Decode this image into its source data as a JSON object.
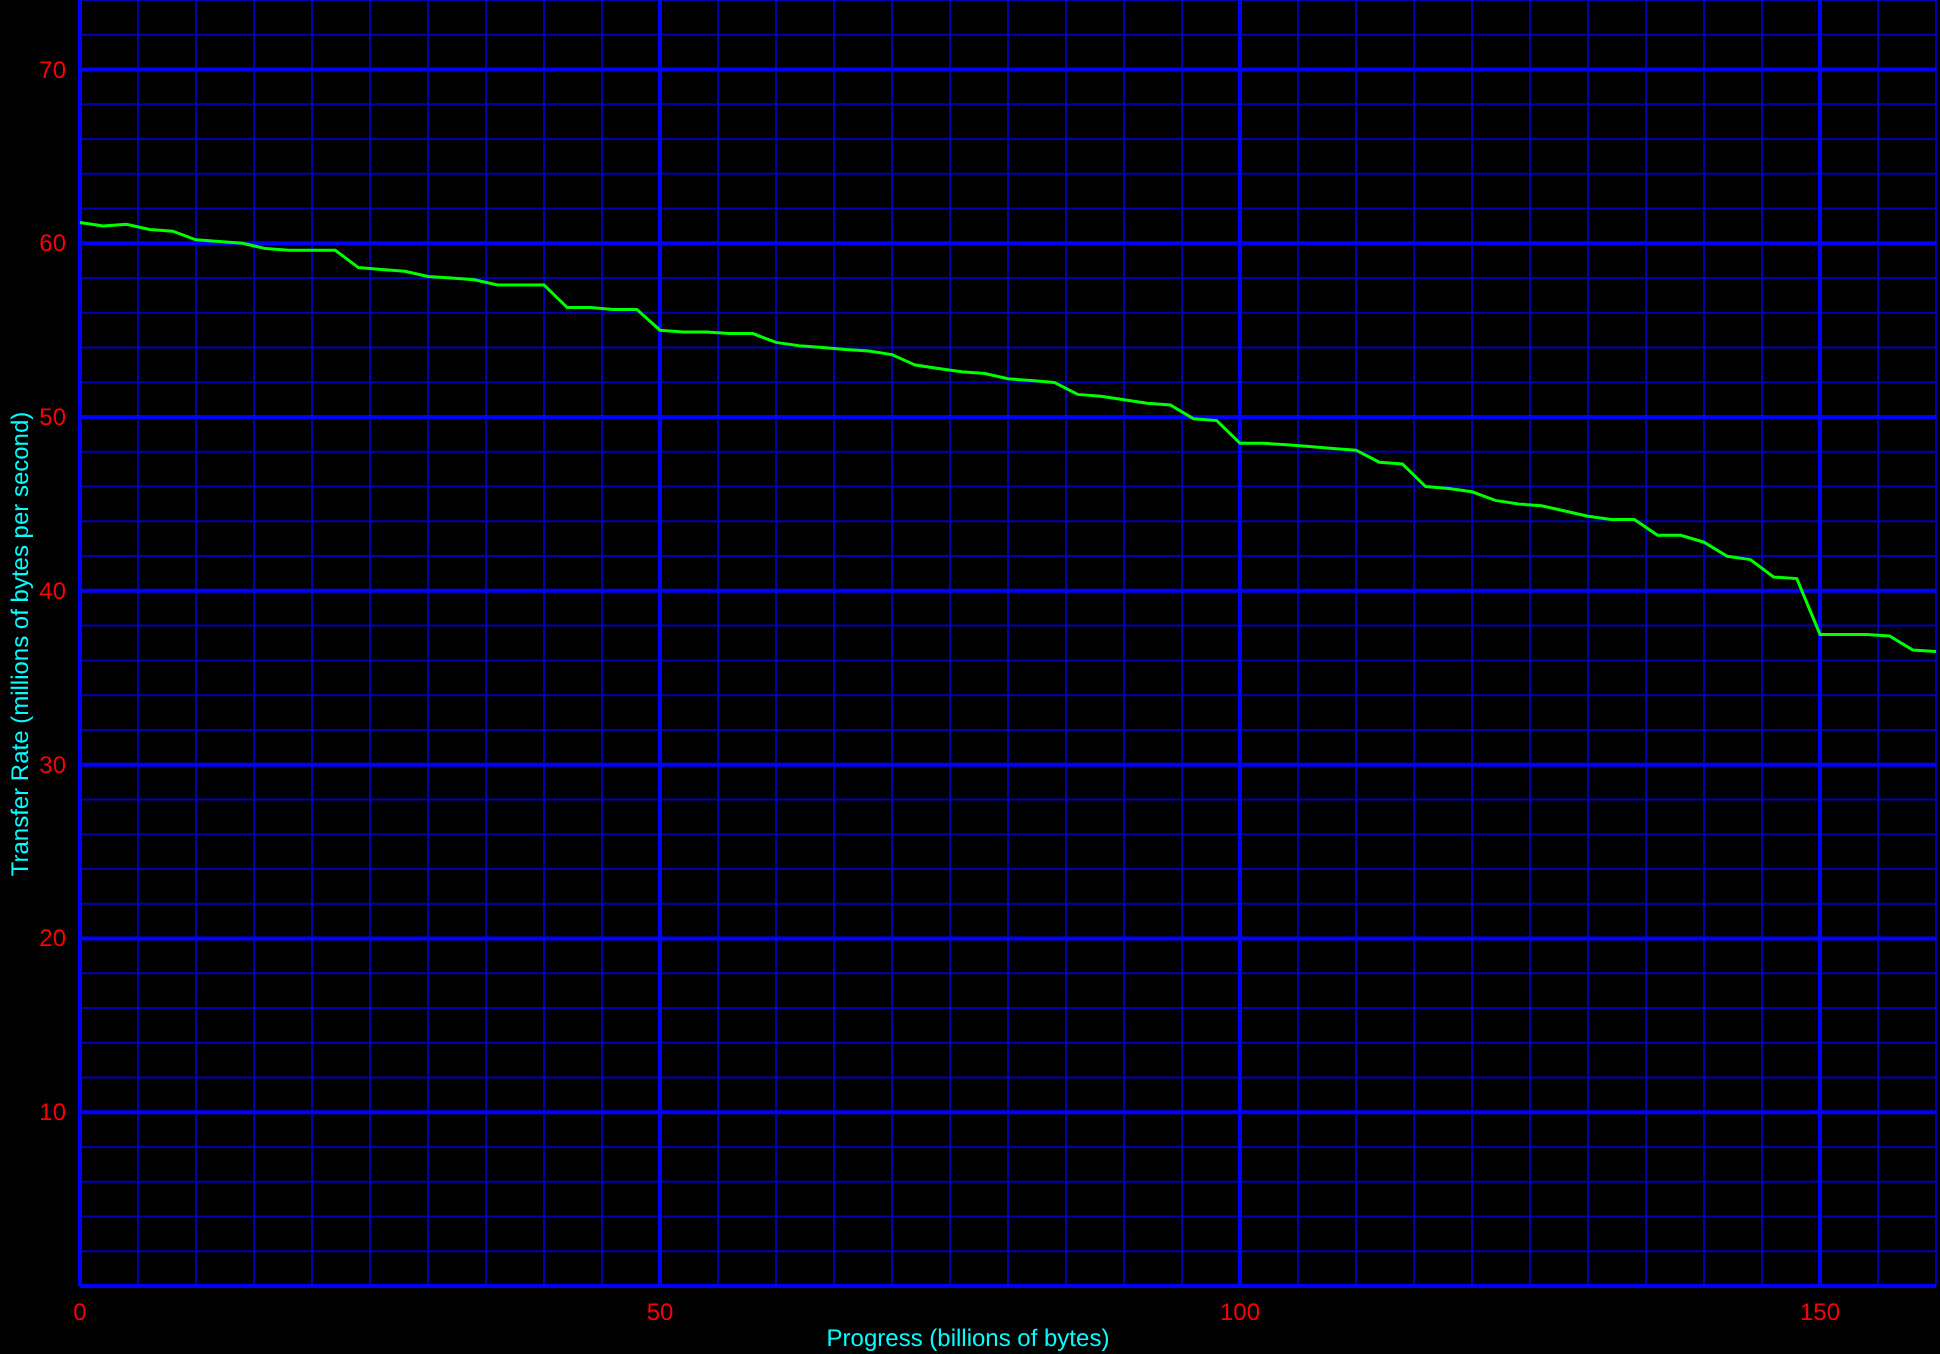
{
  "chart_data": {
    "type": "line",
    "xlabel": "Progress (billions of bytes)",
    "ylabel": "Transfer Rate (millions of bytes per second)",
    "x": [
      0,
      2,
      4,
      6,
      8,
      10,
      12,
      14,
      16,
      18,
      20,
      22,
      24,
      26,
      28,
      30,
      32,
      34,
      36,
      38,
      40,
      42,
      44,
      46,
      48,
      50,
      52,
      54,
      56,
      58,
      60,
      62,
      64,
      66,
      68,
      70,
      72,
      74,
      76,
      78,
      80,
      82,
      84,
      86,
      88,
      90,
      92,
      94,
      96,
      98,
      100,
      102,
      104,
      106,
      108,
      110,
      112,
      114,
      116,
      118,
      120,
      122,
      124,
      126,
      128,
      130,
      132,
      134,
      136,
      138,
      140,
      142,
      144,
      146,
      148,
      150,
      152,
      154,
      156,
      158,
      160
    ],
    "grid": true,
    "series": [
      {
        "color": "#00ff00",
        "values": [
          61.2,
          61.0,
          61.1,
          60.8,
          60.7,
          60.2,
          60.1,
          60.0,
          59.7,
          59.6,
          59.6,
          59.6,
          58.6,
          58.5,
          58.4,
          58.1,
          58.0,
          57.9,
          57.6,
          57.6,
          57.6,
          56.3,
          56.3,
          56.2,
          56.2,
          55.0,
          54.9,
          54.9,
          54.8,
          54.8,
          54.3,
          54.1,
          54.0,
          53.9,
          53.8,
          53.6,
          53.0,
          52.8,
          52.6,
          52.5,
          52.2,
          52.1,
          52.0,
          51.3,
          51.2,
          51.0,
          50.8,
          50.7,
          49.9,
          49.8,
          48.5,
          48.5,
          48.4,
          48.3,
          48.2,
          48.1,
          47.4,
          47.3,
          46.0,
          45.9,
          45.7,
          45.2,
          45.0,
          44.9,
          44.6,
          44.3,
          44.1,
          44.1,
          43.2,
          43.2,
          42.8,
          42.0,
          41.8,
          40.8,
          40.7,
          37.5,
          37.5,
          37.5,
          37.4,
          36.6,
          36.5
        ]
      }
    ],
    "xlim": [
      0,
      160
    ],
    "ylim": [
      0,
      74
    ],
    "xticks": [
      0,
      50,
      100,
      150
    ],
    "yticks": [
      10,
      20,
      30,
      40,
      50,
      60,
      70
    ]
  }
}
